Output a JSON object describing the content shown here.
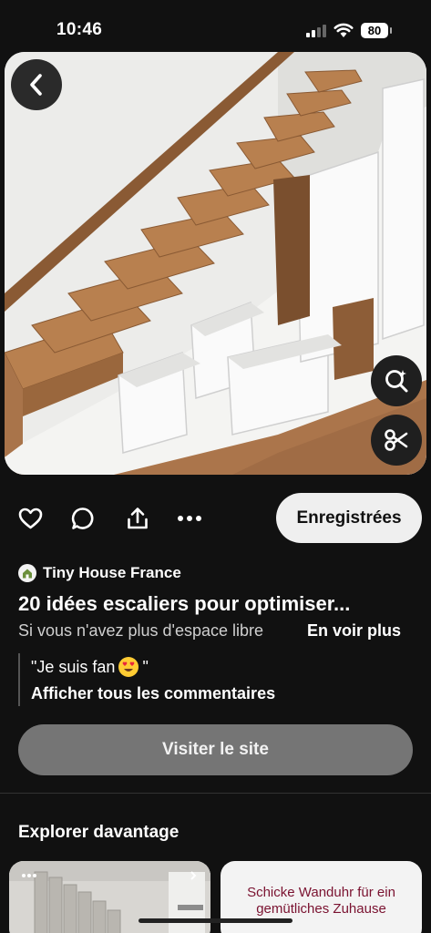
{
  "status_bar": {
    "time": "10:46",
    "battery": "80"
  },
  "pin": {
    "source_name": "Tiny House France",
    "title": "20 idées escaliers pour optimiser...",
    "description": "Si vous n'avez plus d'espace libre",
    "see_more": "En voir plus",
    "comment": "\"Je suis fan 😍 \"",
    "comment_quote": "\"Je suis fan",
    "comment_end": "\"",
    "show_comments": "Afficher tous les commentaires",
    "save_label": "Enregistrées",
    "visit_label": "Visiter le site"
  },
  "explore": {
    "title": "Explorer davantage",
    "cards": [
      {
        "text": ""
      },
      {
        "text": "Schicke Wanduhr für ein gemütliches Zuhause"
      }
    ]
  },
  "icons": {
    "back": "chevron-left-icon",
    "visual_search": "visual-search-icon",
    "cutout": "scissors-icon",
    "like": "heart-icon",
    "comment": "speech-bubble-icon",
    "share": "share-icon",
    "more": "more-dots-icon"
  },
  "colors": {
    "background": "#111111",
    "save_button": "#efefef",
    "visit_button": "#757575"
  }
}
